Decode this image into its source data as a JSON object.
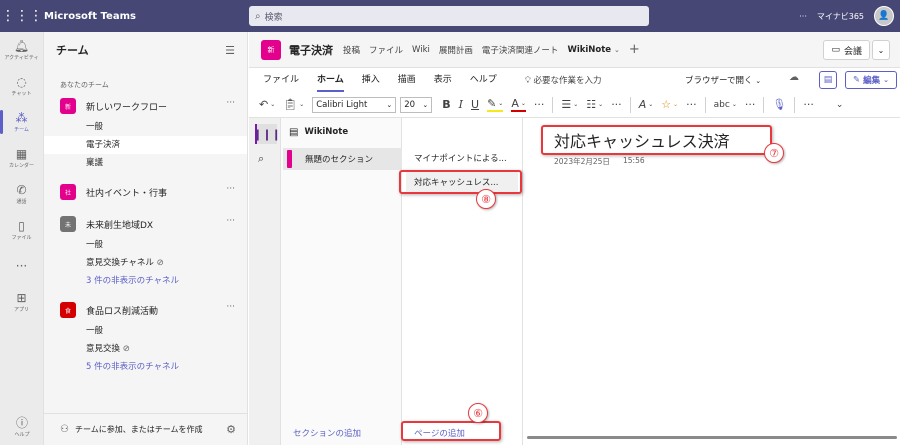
{
  "topbar": {
    "app_name": "Microsoft Teams",
    "search_placeholder": "検索",
    "more": "···",
    "user_name": "マイナビ365"
  },
  "rail": {
    "items": [
      {
        "label": "アクティビティ",
        "icon": "bell-icon"
      },
      {
        "label": "チャット",
        "icon": "chat-icon"
      },
      {
        "label": "チーム",
        "icon": "teams-icon"
      },
      {
        "label": "カレンダー",
        "icon": "calendar-icon"
      },
      {
        "label": "通話",
        "icon": "phone-icon"
      },
      {
        "label": "ファイル",
        "icon": "file-icon"
      },
      {
        "label": "アプリ",
        "icon": "apps-icon"
      },
      {
        "label": "ヘルプ",
        "icon": "help-icon"
      }
    ],
    "more": "···"
  },
  "teams_panel": {
    "title": "チーム",
    "section_label": "あなたのチーム",
    "teams": [
      {
        "avatar": "新",
        "name": "新しいワークフロー",
        "color": "#e3008c",
        "channels": [
          "一般",
          "電子決済",
          "稟議"
        ]
      },
      {
        "avatar": "社",
        "name": "社内イベント・行事",
        "color": "#e3008c",
        "channels": []
      },
      {
        "avatar": "未",
        "name": "未来創生地域DX",
        "color": "#737373",
        "channels": [
          "一般",
          "意見交換チャネル"
        ],
        "hidden": "3 件の非表示のチャネル"
      },
      {
        "avatar": "食",
        "name": "食品ロス削減活動",
        "color": "#d40000",
        "channels": [
          "一般",
          "意見交換"
        ],
        "hidden": "5 件の非表示のチャネル"
      }
    ],
    "footer": "チームに参加、またはチームを作成"
  },
  "channel_header": {
    "avatar": "新",
    "name": "電子決済",
    "tabs": [
      "投稿",
      "ファイル",
      "Wiki",
      "展開計画",
      "電子決済関連ノート",
      "WikiNote"
    ],
    "meet_label": "会議"
  },
  "ribbon": {
    "tabs": [
      "ファイル",
      "ホーム",
      "挿入",
      "描画",
      "表示",
      "ヘルプ"
    ],
    "tell_me": "必要な作業を入力",
    "browser_open": "ブラウザーで開く",
    "edit_label": "編集"
  },
  "toolbar": {
    "font": "Calibri Light",
    "size": "20"
  },
  "notebook": {
    "title": "WikiNote",
    "section": "無題のセクション",
    "add_section": "セクションの追加",
    "pages": [
      "マイナポイントによる...",
      "対応キャッシュレス..."
    ],
    "add_page": "ページの追加"
  },
  "page": {
    "title": "対応キャッシュレス決済",
    "date": "2023年2月25日",
    "time": "15:56"
  },
  "annotations": {
    "n6": "⑥",
    "n7": "⑦",
    "n8": "⑧",
    "color": "#e8383d"
  }
}
